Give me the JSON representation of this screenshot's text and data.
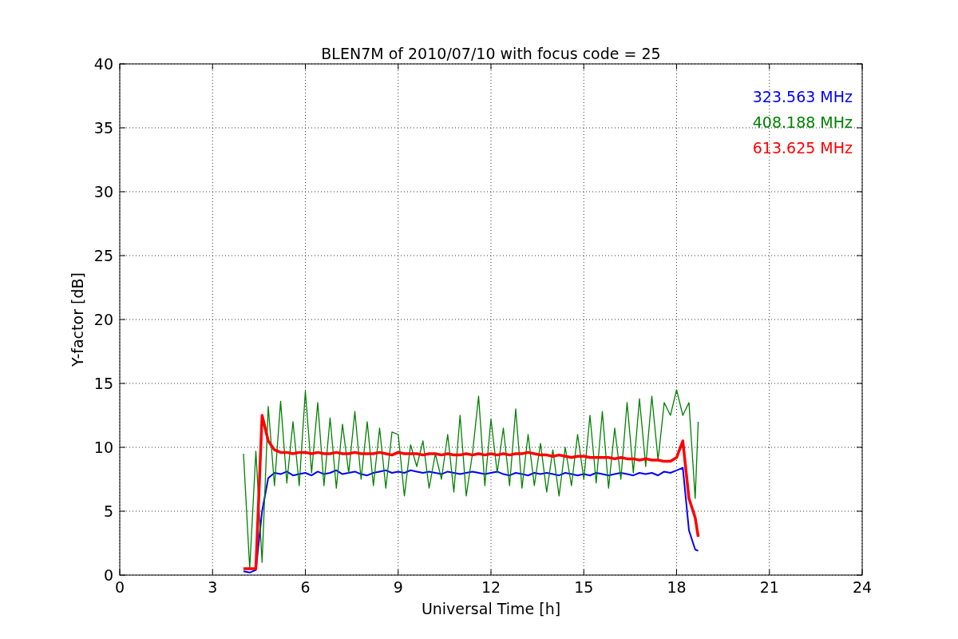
{
  "chart_data": {
    "type": "line",
    "title": "BLEN7M of 2010/07/10 with focus code = 25",
    "xlabel": "Universal Time [h]",
    "ylabel": "Y-factor [dB]",
    "xlim": [
      0,
      24
    ],
    "ylim": [
      0,
      40
    ],
    "xticks": [
      0,
      3,
      6,
      9,
      12,
      15,
      18,
      21,
      24
    ],
    "yticks": [
      0,
      5,
      10,
      15,
      20,
      25,
      30,
      35,
      40
    ],
    "grid": true,
    "x": [
      4.0,
      4.2,
      4.4,
      4.6,
      4.8,
      5.0,
      5.2,
      5.4,
      5.6,
      5.8,
      6.0,
      6.2,
      6.4,
      6.6,
      6.8,
      7.0,
      7.2,
      7.4,
      7.6,
      7.8,
      8.0,
      8.2,
      8.4,
      8.6,
      8.8,
      9.0,
      9.2,
      9.4,
      9.6,
      9.8,
      10.0,
      10.2,
      10.4,
      10.6,
      10.8,
      11.0,
      11.2,
      11.4,
      11.6,
      11.8,
      12.0,
      12.2,
      12.4,
      12.6,
      12.8,
      13.0,
      13.2,
      13.4,
      13.6,
      13.8,
      14.0,
      14.2,
      14.4,
      14.6,
      14.8,
      15.0,
      15.2,
      15.4,
      15.6,
      15.8,
      16.0,
      16.2,
      16.4,
      16.6,
      16.8,
      17.0,
      17.2,
      17.4,
      17.6,
      17.8,
      18.0,
      18.2,
      18.4,
      18.6,
      18.7
    ],
    "series": [
      {
        "name": "323.563 MHz",
        "color": "#0000ff",
        "values": [
          0.3,
          0.2,
          0.4,
          5.0,
          7.6,
          8.0,
          7.9,
          8.1,
          7.8,
          7.9,
          8.0,
          7.8,
          8.1,
          7.9,
          8.0,
          8.2,
          7.9,
          8.0,
          8.1,
          7.9,
          7.8,
          8.0,
          8.1,
          8.2,
          8.0,
          8.1,
          8.0,
          8.2,
          8.1,
          8.0,
          8.1,
          8.0,
          7.9,
          8.1,
          8.0,
          7.9,
          8.0,
          8.1,
          8.0,
          7.9,
          8.0,
          8.1,
          7.9,
          7.8,
          8.0,
          7.9,
          7.8,
          8.0,
          7.9,
          8.0,
          7.9,
          7.8,
          8.0,
          7.9,
          7.8,
          7.9,
          7.8,
          8.0,
          7.9,
          7.8,
          7.9,
          8.0,
          7.9,
          7.8,
          8.0,
          7.9,
          8.0,
          7.8,
          8.1,
          8.0,
          8.2,
          8.4,
          3.5,
          2.0,
          1.9
        ]
      },
      {
        "name": "408.188 MHz",
        "color": "#008000",
        "values": [
          9.5,
          0.5,
          9.7,
          1.0,
          13.2,
          7.0,
          13.6,
          7.2,
          12.0,
          7.0,
          14.4,
          8.0,
          13.5,
          7.0,
          12.3,
          6.8,
          11.8,
          8.0,
          12.8,
          7.5,
          12.0,
          7.0,
          11.5,
          6.8,
          11.2,
          11.0,
          6.2,
          10.2,
          8.5,
          10.5,
          6.8,
          9.5,
          7.5,
          11.0,
          6.5,
          12.5,
          6.2,
          9.5,
          14.0,
          7.0,
          12.2,
          8.0,
          11.5,
          7.0,
          13.0,
          6.8,
          11.0,
          7.0,
          10.3,
          6.5,
          9.8,
          6.2,
          10.0,
          7.0,
          11.0,
          7.5,
          12.5,
          7.2,
          12.8,
          6.8,
          11.5,
          7.5,
          13.5,
          8.0,
          13.8,
          8.5,
          14.0,
          9.0,
          13.5,
          12.5,
          14.5,
          12.5,
          13.5,
          6.0,
          12.0
        ]
      },
      {
        "name": "613.625 MHz",
        "color": "#ff0000",
        "values": [
          0.5,
          0.5,
          0.5,
          12.5,
          10.5,
          9.8,
          9.6,
          9.6,
          9.5,
          9.6,
          9.6,
          9.5,
          9.6,
          9.5,
          9.5,
          9.6,
          9.5,
          9.5,
          9.6,
          9.5,
          9.5,
          9.5,
          9.6,
          9.5,
          9.4,
          9.6,
          9.5,
          9.5,
          9.5,
          9.4,
          9.5,
          9.5,
          9.4,
          9.5,
          9.4,
          9.4,
          9.5,
          9.4,
          9.5,
          9.4,
          9.5,
          9.4,
          9.5,
          9.4,
          9.5,
          9.5,
          9.6,
          9.5,
          9.4,
          9.4,
          9.3,
          9.4,
          9.3,
          9.2,
          9.3,
          9.3,
          9.2,
          9.2,
          9.2,
          9.2,
          9.1,
          9.2,
          9.1,
          9.1,
          9.0,
          9.1,
          9.0,
          9.0,
          8.9,
          8.9,
          9.2,
          10.5,
          6.0,
          4.5,
          3.0
        ]
      }
    ]
  }
}
